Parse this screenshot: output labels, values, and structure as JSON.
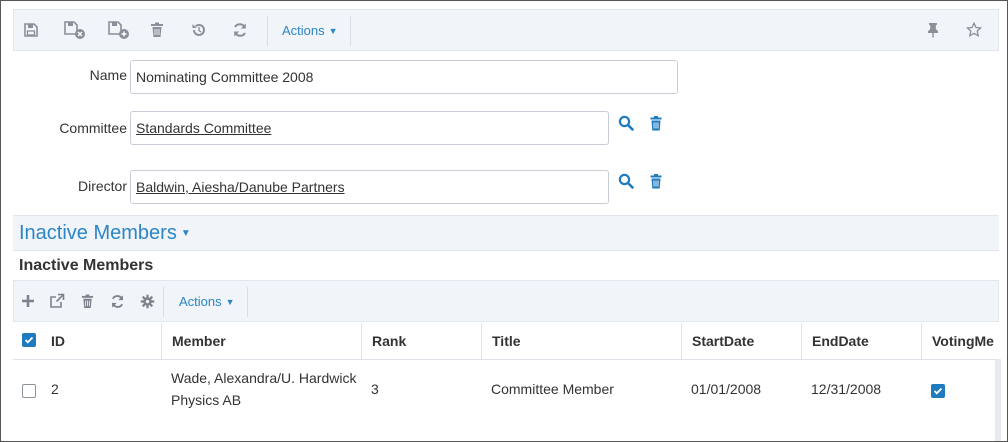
{
  "toolbar": {
    "actions_label": "Actions"
  },
  "form": {
    "name_label": "Name",
    "name_value": "Nominating Committee 2008",
    "committee_label": "Committee",
    "committee_value": "Standards Committee",
    "director_label": "Director",
    "director_value": "Baldwin, Aiesha/Danube Partners"
  },
  "section": {
    "title": "Inactive Members",
    "subtitle": "Inactive Members"
  },
  "grid": {
    "actions_label": "Actions",
    "columns": [
      "ID",
      "Member",
      "Rank",
      "Title",
      "StartDate",
      "EndDate",
      "VotingMe"
    ],
    "rows": [
      {
        "id": "2",
        "member_line1": "Wade, Alexandra/U. Hardwick",
        "member_line2": "Physics AB",
        "rank": "3",
        "title": "Committee Member",
        "start_date": "01/01/2008",
        "end_date": "12/31/2008",
        "voting": true,
        "selected": false
      }
    ],
    "select_all": true
  },
  "colors": {
    "accent": "#2a86c6",
    "toolbar_bg": "#f1f4f8",
    "icon_gray": "#8a9099"
  }
}
